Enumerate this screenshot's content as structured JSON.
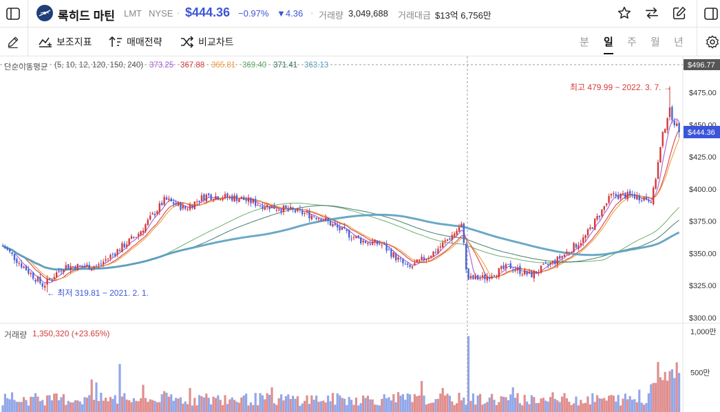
{
  "header": {
    "name": "록히드 마틴",
    "ticker": "LMT",
    "exchange": "NYSE",
    "dot": "·",
    "price": "$444.36",
    "change_pct": "−0.97%",
    "change_abs": "▼4.36",
    "volume_label": "거래량",
    "volume_value": "3,049,688",
    "turnover_label": "거래대금",
    "turnover_value": "$13억 6,756만"
  },
  "toolbar": {
    "indicators": "보조지표",
    "strategy": "매매전략",
    "compare": "비교차트",
    "timeframes": [
      "분",
      "일",
      "주",
      "월",
      "년"
    ],
    "active_timeframe": "일"
  },
  "ma_legend": {
    "title": "단순이동평균",
    "params": "(5, 10, 12, 120, 150, 240)",
    "values": [
      "373.25",
      "367.88",
      "365.81",
      "369.40",
      "371.41",
      "363.13"
    ]
  },
  "price_axis": {
    "ticks": [
      "$475.00",
      "$450.00",
      "$425.00",
      "$400.00",
      "$375.00",
      "$350.00",
      "$325.00",
      "$300.00"
    ],
    "crosshair_label": "$496.77",
    "last_price_label": "$444.36"
  },
  "annotations": {
    "high": "최고 479.99 − 2022. 3. 7. →",
    "low": "← 최저 319.81 − 2021. 2. 1."
  },
  "volume_panel": {
    "label": "거래량",
    "value": "1,350,320 (+23.65%)",
    "ticks": [
      "1,000만",
      "500만"
    ]
  },
  "colors": {
    "up": "#d4383a",
    "down": "#4a63d6",
    "accent": "#3b55d9",
    "ma_colors": [
      "#a556d6",
      "#d33c3a",
      "#ef9a36",
      "#5aa65a",
      "#2f6e5e",
      "#5a9ec0"
    ],
    "vol_up": "#e08e8e",
    "vol_down": "#92a7e8"
  },
  "chart_data": {
    "type": "candlestick",
    "title": "록히드 마틴 LMT",
    "ylim": [
      300,
      496.77
    ],
    "price_path": [
      [
        0,
        356
      ],
      [
        0.03,
        340
      ],
      [
        0.06,
        325
      ],
      [
        0.09,
        340
      ],
      [
        0.14,
        340
      ],
      [
        0.2,
        365
      ],
      [
        0.24,
        392
      ],
      [
        0.27,
        385
      ],
      [
        0.3,
        395
      ],
      [
        0.35,
        393
      ],
      [
        0.38,
        388
      ],
      [
        0.43,
        383
      ],
      [
        0.47,
        378
      ],
      [
        0.5,
        368
      ],
      [
        0.53,
        360
      ],
      [
        0.56,
        357
      ],
      [
        0.6,
        338
      ],
      [
        0.64,
        352
      ],
      [
        0.68,
        372
      ],
      [
        0.686,
        330
      ],
      [
        0.71,
        331
      ],
      [
        0.75,
        340
      ],
      [
        0.78,
        333
      ],
      [
        0.82,
        345
      ],
      [
        0.86,
        362
      ],
      [
        0.9,
        395
      ],
      [
        0.93,
        395
      ],
      [
        0.96,
        392
      ],
      [
        0.975,
        440
      ],
      [
        0.985,
        462
      ],
      [
        1.0,
        444
      ]
    ],
    "high": {
      "value": 479.99,
      "date": "2022. 3. 7."
    },
    "low": {
      "value": 319.81,
      "date": "2021. 2. 1."
    },
    "last": 444.36,
    "moving_averages": [
      {
        "name": "5",
        "value": 373.25
      },
      {
        "name": "10",
        "value": 367.88
      },
      {
        "name": "12",
        "value": 365.81
      },
      {
        "name": "120",
        "value": 369.4
      },
      {
        "name": "150",
        "value": 371.41
      },
      {
        "name": "240",
        "value": 363.13
      }
    ],
    "volume_ylim": [
      0,
      10000000
    ],
    "last_volume": 1350320
  }
}
